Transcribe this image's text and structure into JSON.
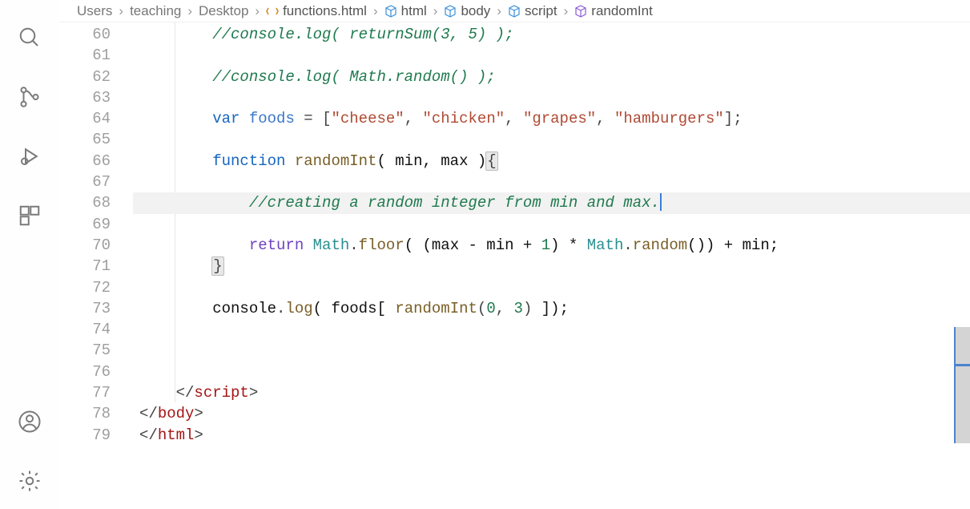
{
  "breadcrumb": {
    "users": "Users",
    "teaching": "teaching",
    "desktop": "Desktop",
    "file": "functions.html",
    "sym_html": "html",
    "sym_body": "body",
    "sym_script": "script",
    "sym_func": "randomInt"
  },
  "lines": {
    "start": 60,
    "end": 79,
    "numbers": [
      "60",
      "61",
      "62",
      "63",
      "64",
      "65",
      "66",
      "67",
      "68",
      "69",
      "70",
      "71",
      "72",
      "73",
      "74",
      "75",
      "76",
      "77",
      "78",
      "79"
    ]
  },
  "code": {
    "l60_comment": "//console.log( returnSum(3, 5) );",
    "l62_comment": "//console.log( Math.random() );",
    "l64_var": "var",
    "l64_name": "foods",
    "l64_eq": " = [",
    "l64_s1": "\"cheese\"",
    "l64_s2": "\"chicken\"",
    "l64_s3": "\"grapes\"",
    "l64_s4": "\"hamburgers\"",
    "l64_end": "];",
    "l66_kw": "function",
    "l66_fn": "randomInt",
    "l66_params": "( min, max )",
    "l66_brace": "{",
    "l68_comment": "//creating a random integer from min and max.",
    "l70_return": "return",
    "l70_math1": "Math",
    "l70_floor": "floor",
    "l70_mid": "( (max - min + ",
    "l70_one": "1",
    "l70_mid2": ") * ",
    "l70_math2": "Math",
    "l70_random": "random",
    "l70_end": "()) + min;",
    "l71_brace": "}",
    "l73_console": "console",
    "l73_log": "log",
    "l73_open": "( foods[ ",
    "l73_fn": "randomInt",
    "l73_args_open": "(",
    "l73_a0": "0",
    "l73_comma": ", ",
    "l73_a1": "3",
    "l73_args_close": ")",
    "l73_close": " ]);",
    "l77_close_script_open": "</",
    "l77_close_script_tag": "script",
    "l77_close_script_end": ">",
    "l78_close_body_open": "</",
    "l78_close_body_tag": "body",
    "l78_close_body_end": ">",
    "l79_close_html_open": "</",
    "l79_close_html_tag": "html",
    "l79_close_html_end": ">"
  },
  "cursor": {
    "line": 68,
    "after_text": true
  }
}
